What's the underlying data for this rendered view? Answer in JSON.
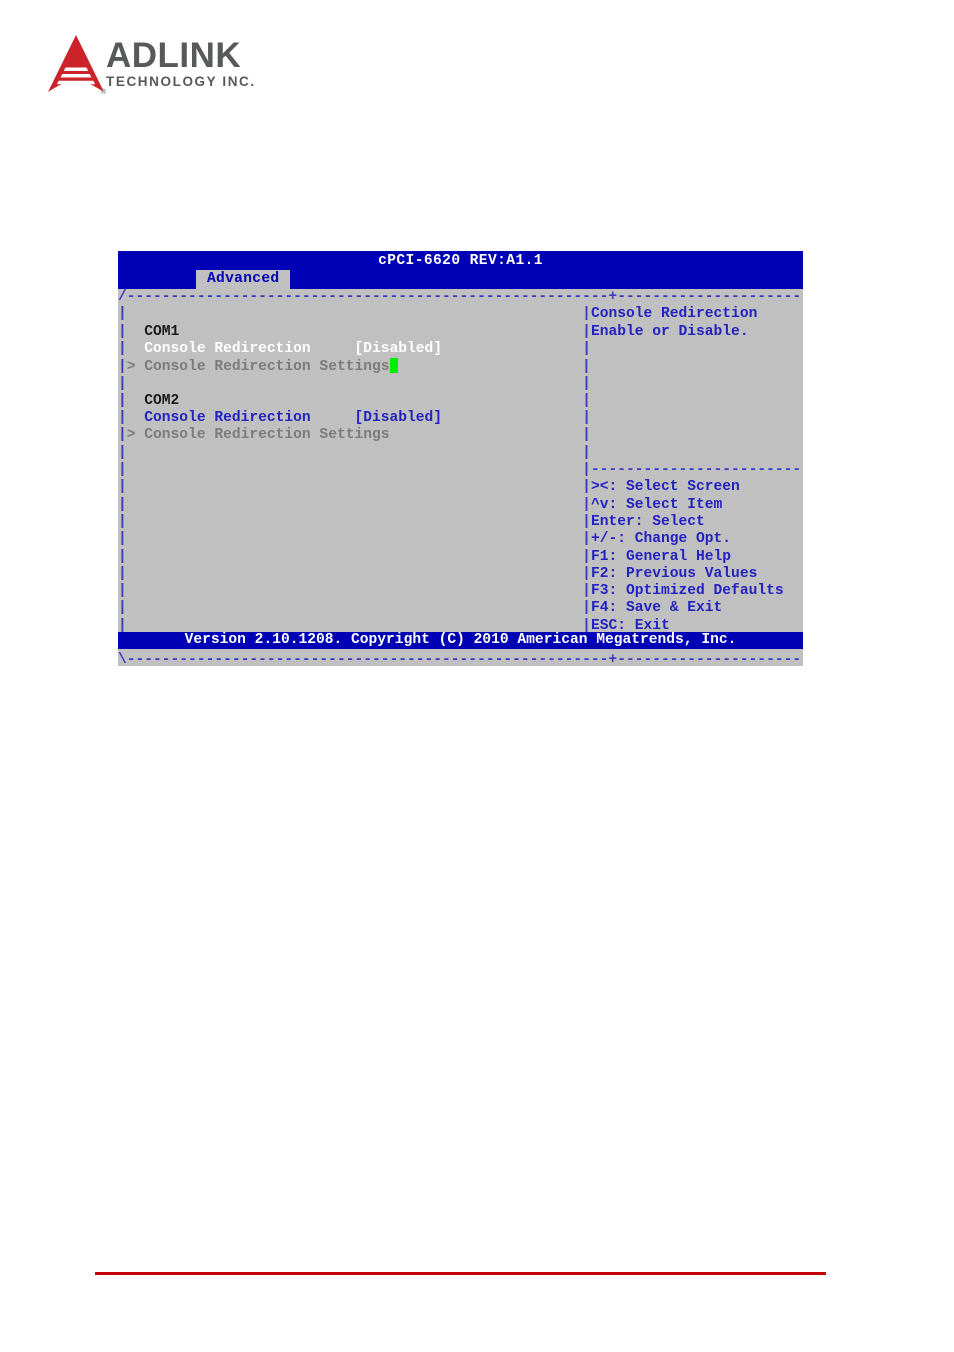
{
  "brand": {
    "name": "ADLINK",
    "tagline": "TECHNOLOGY INC.",
    "registered_mark": "®",
    "logo_color": "#cc2229",
    "wordmark_color": "#58595b"
  },
  "bios": {
    "title": "cPCI-6620 REV:A1.1",
    "tab": "Advanced",
    "footer": "Version 2.10.1208. Copyright (C) 2010 American Megatrends, Inc.",
    "colors": {
      "screen_bg": "#c0c0c0",
      "bar_bg": "#0000b4",
      "frame": "#3939c8",
      "selected_text": "#ffffff",
      "normal_text": "#2222c0",
      "dim_text": "#7b7b7b",
      "section_text": "#1a1a1a",
      "cursor": "#00ee00"
    },
    "frame": {
      "top": "/-------------------------------------------------------+-------------------------\\",
      "side": "|",
      "divider": "|-------------------------|",
      "bottom": "\\-------------------------------------------------------+-------------------------/"
    },
    "left_panel": {
      "groups": [
        {
          "heading": "COM1",
          "items": [
            {
              "arrow": "",
              "label": "Console Redirection",
              "value": "[Disabled]",
              "state": "selected",
              "cursor": false
            },
            {
              "arrow": ">",
              "label": "Console Redirection Settings",
              "value": "",
              "state": "dim",
              "cursor": true
            }
          ]
        },
        {
          "heading": "COM2",
          "items": [
            {
              "arrow": "",
              "label": "Console Redirection",
              "value": "[Disabled]",
              "state": "normal",
              "cursor": false
            },
            {
              "arrow": ">",
              "label": "Console Redirection Settings",
              "value": "",
              "state": "dim",
              "cursor": false
            }
          ]
        }
      ]
    },
    "help_panel": {
      "lines": [
        "Console Redirection",
        "Enable or Disable."
      ],
      "keys": [
        "><: Select Screen",
        "^v: Select Item",
        "Enter: Select",
        "+/-: Change Opt.",
        "F1: General Help",
        "F2: Previous Values",
        "F3: Optimized Defaults",
        "F4: Save & Exit",
        "ESC: Exit"
      ]
    }
  }
}
